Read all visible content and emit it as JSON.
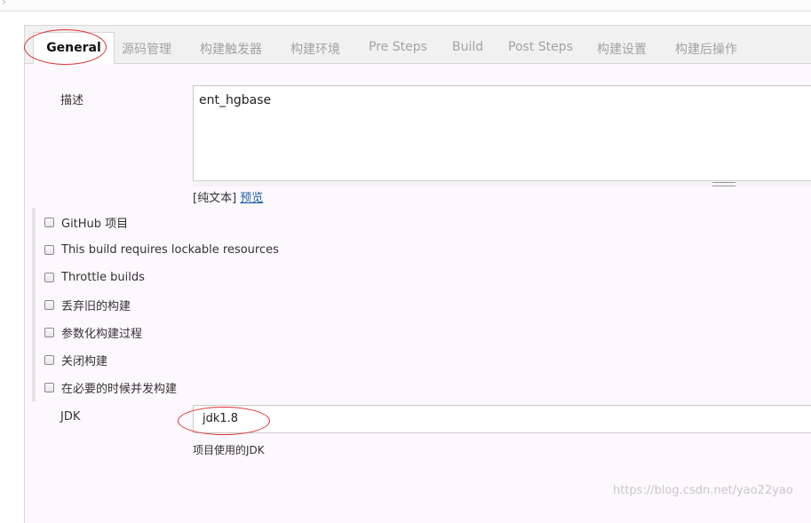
{
  "header": {
    "chevron_icon": "chevron-right-icon"
  },
  "tabs": [
    {
      "label": "General",
      "active": true
    },
    {
      "label": "源码管理"
    },
    {
      "label": "构建触发器"
    },
    {
      "label": "构建环境"
    },
    {
      "label": "Pre Steps"
    },
    {
      "label": "Build"
    },
    {
      "label": "Post Steps"
    },
    {
      "label": "构建设置"
    },
    {
      "label": "构建后操作"
    }
  ],
  "description": {
    "label": "描述",
    "value": "ent_hgbase",
    "plain_text_open": "[纯文本]",
    "preview_link": "预览"
  },
  "options": [
    {
      "label": "GitHub 项目",
      "checked": false
    },
    {
      "label": "This build requires lockable resources",
      "checked": false
    },
    {
      "label": "Throttle builds",
      "checked": false
    },
    {
      "label": "丢弃旧的构建",
      "checked": false
    },
    {
      "label": "参数化构建过程",
      "checked": false
    },
    {
      "label": "关闭构建",
      "checked": false
    },
    {
      "label": "在必要的时候并发构建",
      "checked": false
    }
  ],
  "jdk": {
    "label": "JDK",
    "value": "jdk1.8",
    "help": "项目使用的JDK"
  },
  "watermark": "https://blog.csdn.net/yao22yao",
  "colors": {
    "annotation": "#e03030",
    "link": "#1a5fa8",
    "panel_bg": "#fdf8fd",
    "tabbar_bg": "#f1f1f1"
  }
}
